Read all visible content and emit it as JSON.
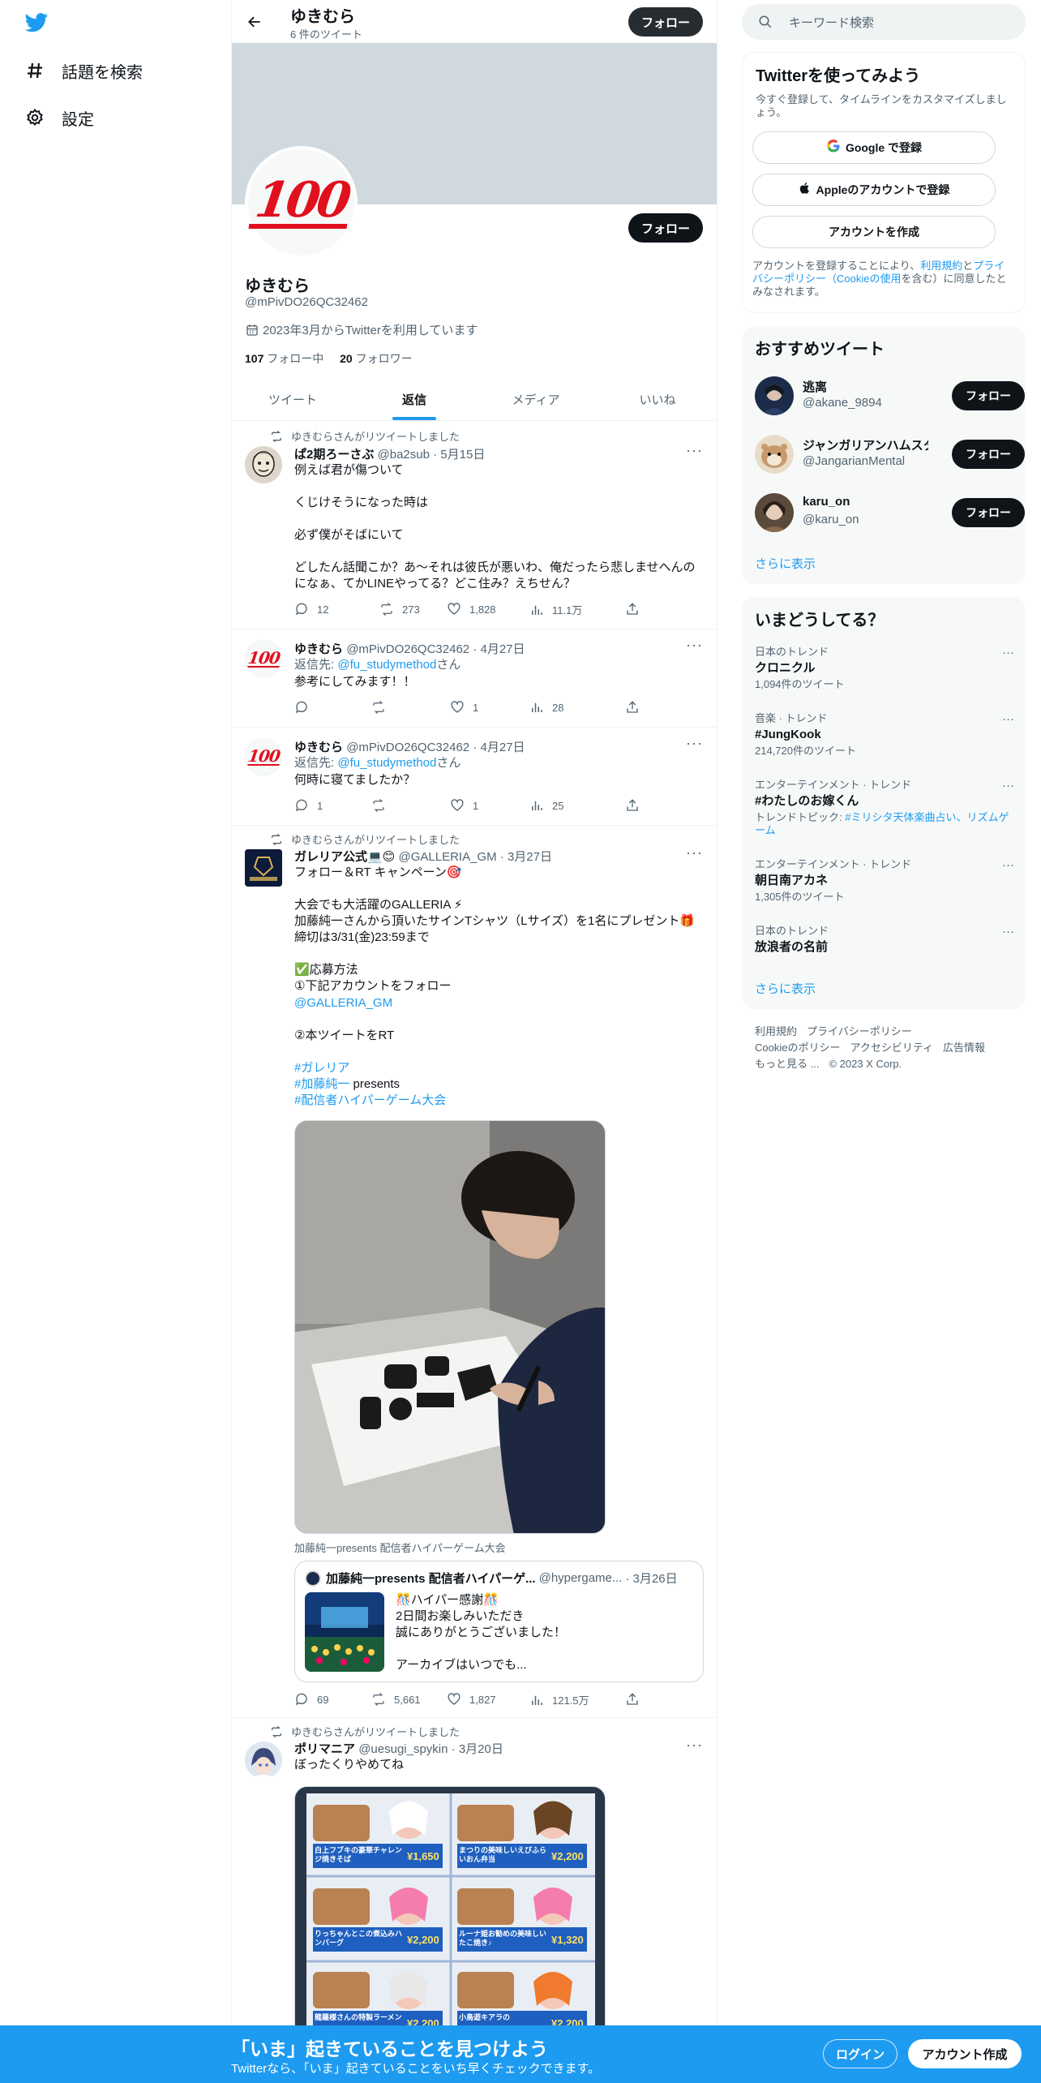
{
  "nav": {
    "explore_label": "話題を検索",
    "settings_label": "設定"
  },
  "header": {
    "name": "ゆきむら",
    "tweet_count": "6 件のツイート",
    "follow_label": "フォロー"
  },
  "profile": {
    "name": "ゆきむら",
    "handle": "@mPivDO26QC32462",
    "joined": "2023年3月からTwitterを利用しています",
    "following_count": "107",
    "following_label": " フォロー中",
    "followers_count": "20",
    "followers_label": " フォロワー",
    "follow_label": "フォロー"
  },
  "tabs": [
    {
      "label": "ツイート"
    },
    {
      "label": "返信"
    },
    {
      "label": "メディア"
    },
    {
      "label": "いいね"
    }
  ],
  "tweets": [
    {
      "retweet_label": "ゆきむらさんがリツイートしました",
      "name": "ぱ2期ろーさぶ",
      "handle": "@ba2sub",
      "date": "· 5月15日",
      "body": "例えば君が傷ついて\n\nくじけそうになった時は\n\n必ず僕がそばにいて\n\nどしたん話聞こか？あ〜それは彼氏が悪いわ、俺だったら悲しませへんのになぁ、てかLINEやってる？どこ住み？えちせん？",
      "replies": "12",
      "retweets": "273",
      "likes": "1,828",
      "views": "11.1万"
    },
    {
      "name": "ゆきむら",
      "handle": "@mPivDO26QC32462",
      "date": "· 4月27日",
      "reply_prefix": "返信先: ",
      "reply_to": "@fu_studymethod",
      "reply_suffix": "さん",
      "body": "参考にしてみます！！",
      "replies": "",
      "retweets": "",
      "likes": "1",
      "views": "28"
    },
    {
      "name": "ゆきむら",
      "handle": "@mPivDO26QC32462",
      "date": "· 4月27日",
      "reply_prefix": "返信先: ",
      "reply_to": "@fu_studymethod",
      "reply_suffix": "さん",
      "body": "何時に寝てましたか？",
      "replies": "1",
      "retweets": "",
      "likes": "1",
      "views": "25"
    },
    {
      "retweet_label": "ゆきむらさんがリツイートしました",
      "name": "ガレリア公式💻😊",
      "handle": "@GALLERIA_GM",
      "date": "· 3月27日",
      "body1": "フォロー＆RT キャンペーン🎯\n\n大会でも大活躍のGALLERIA ⚡\n加藤純一さんから頂いたサインTシャツ（Lサイズ）を1名にプレゼント🎁\n締切は3/31(金)23:59まで\n\n✅応募方法\n①下記アカウントをフォロー",
      "link1": "@GALLERIA_GM",
      "body2": "②本ツイートをRT",
      "hashtag1": "#ガレリア",
      "hashtag2": "#加藤純一",
      "hashtag2_suffix": " presents",
      "hashtag3": "#配信者ハイパーゲーム大会",
      "caption": "加藤純一presents 配信者ハイパーゲーム大会",
      "quote": {
        "name": "加藤純一presents 配信者ハイパーゲ...",
        "handle": "@hypergame...",
        "date": "· 3月26日",
        "body": "🎊ハイパー感謝🎊\n2日間お楽しみいただき\n誠にありがとうございました！\n\nアーカイブはいつでも..."
      },
      "replies": "69",
      "retweets": "5,661",
      "likes": "1,827",
      "views": "121.5万"
    },
    {
      "retweet_label": "ゆきむらさんがリツイートしました",
      "name": "ポリマニア",
      "handle": "@uesugi_spykin",
      "date": "· 3月20日",
      "body": "ぼったくりやめてね",
      "poster": {
        "c1": "白上フブキの豪華チャレンジ焼きそば",
        "p1": "¥1,650",
        "c2": "まつりの美味しいえびふらいおん弁当",
        "p2": "¥2,200",
        "c3": "りっちゃんとこの煮込みハンバーグ",
        "p3": "¥2,200",
        "c4": "ルーナ姫お勧めの美味しいたこ焼き♪",
        "p4": "¥1,320",
        "c5": "龍羅様さんの特製ラーメン",
        "p5": "¥2,200",
        "c6": "小鳥遊キアラの",
        "p6": "¥2,200"
      }
    }
  ],
  "right": {
    "search_placeholder": "キーワード検索",
    "signup": {
      "title": "Twitterを使ってみよう",
      "subtitle": "今すぐ登録して、タイムラインをカスタマイズしましょう。",
      "google": "Google で登録",
      "apple": "Appleのアカウントで登録",
      "create": "アカウントを作成",
      "legal1": "アカウントを登録することにより、",
      "legal_terms": "利用規約",
      "legal2": "と",
      "legal_privacy": "プライバシーポリシー（Cookieの使用",
      "legal3": "を含む）に同意したとみなされます。"
    },
    "recommend": {
      "title": "おすすめツイート",
      "items": [
        {
          "name": "逃离",
          "handle": "@akane_9894"
        },
        {
          "name": "ジャンガリアンハムスター...",
          "handle": "@JangarianMental"
        },
        {
          "name": "karu_on",
          "handle": "@karu_on"
        }
      ],
      "follow_label": "フォロー",
      "more": "さらに表示"
    },
    "trends": {
      "title": "いまどうしてる？",
      "items": [
        {
          "category": "日本のトレンド",
          "name": "クロニクル",
          "sub": "1,094件のツイート"
        },
        {
          "category": "音楽 · トレンド",
          "name": "#JungKook",
          "sub": "214,720件のツイート"
        },
        {
          "category": "エンターテインメント · トレンド",
          "name": "#わたしのお嫁くん",
          "topic_prefix": "トレンドトピック: ",
          "topic": "#ミリシタ天体楽曲占い、リズムゲーム"
        },
        {
          "category": "エンターテインメント · トレンド",
          "name": "朝日南アカネ",
          "sub": "1,305件のツイート"
        },
        {
          "category": "日本のトレンド",
          "name": "放浪者の名前"
        }
      ],
      "more": "さらに表示"
    },
    "footer": {
      "terms": "利用規約",
      "privacy": "プライバシーポリシー",
      "cookie": "Cookieのポリシー",
      "accessibility": "アクセシビリティ",
      "ads": "広告情報",
      "more": "もっと見る ...",
      "copyright": "© 2023 X Corp."
    }
  },
  "bottom_bar": {
    "title": "「いま」起きていることを見つけよう",
    "subtitle": "Twitterなら、「いま」起きていることをいち早くチェックできます。",
    "login": "ログイン",
    "signup": "アカウント作成"
  },
  "colors": {
    "accent": "#1d9bf0",
    "banner": "#cfd9de",
    "text": "#0f1419",
    "muted": "#536471"
  }
}
